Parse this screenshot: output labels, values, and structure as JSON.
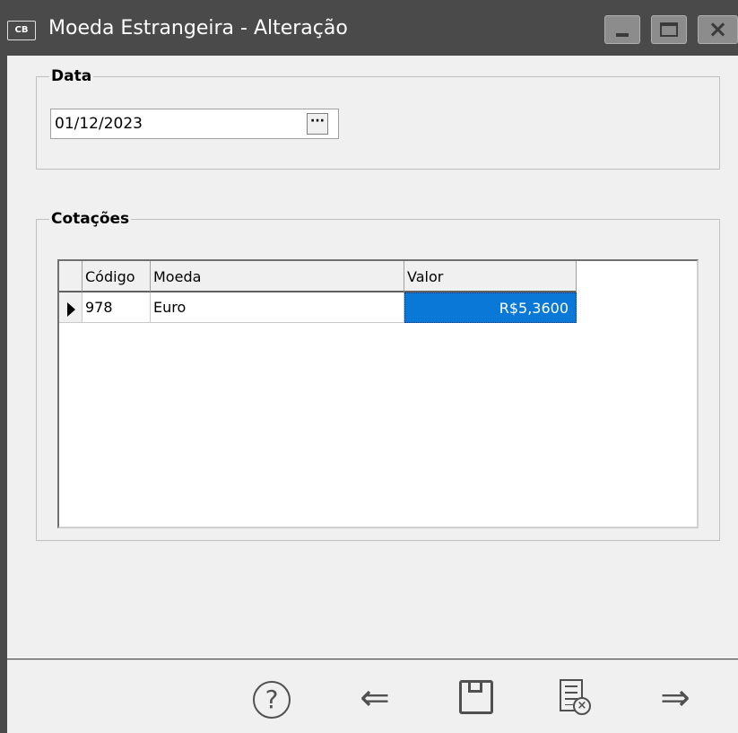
{
  "window": {
    "icon_text": "CB",
    "title": "Moeda Estrangeira - Alteração",
    "controls": {
      "minimize": "minimize-icon",
      "maximize": "maximize-icon",
      "close": "×"
    }
  },
  "data_group": {
    "title": "Data",
    "date_value": "01/12/2023",
    "picker_label": "···"
  },
  "cotacoes_group": {
    "title": "Cotações",
    "columns": [
      "Código",
      "Moeda",
      "Valor"
    ],
    "rows": [
      {
        "codigo": "978",
        "moeda": "Euro",
        "valor": "R$5,3600"
      }
    ]
  },
  "toolbar": {
    "help": "?",
    "back": "⇐",
    "save": "save-icon",
    "cancel_doc": "×",
    "forward": "⇒"
  },
  "colors": {
    "titlebar": "#4a4a4a",
    "client": "#f0f0f0",
    "selection": "#0a78d7"
  }
}
